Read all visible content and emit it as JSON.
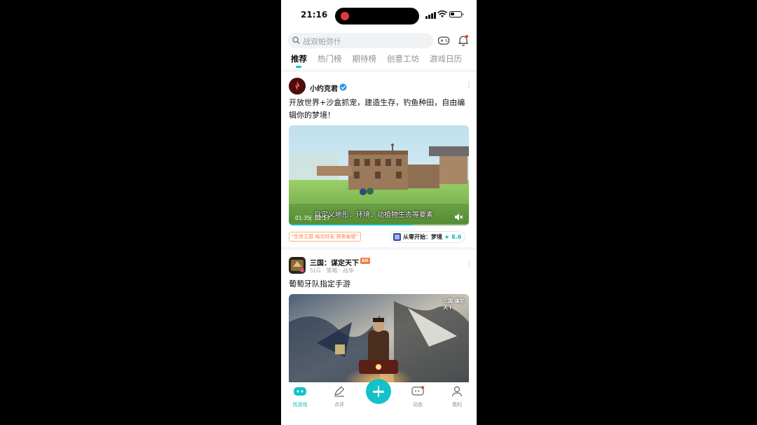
{
  "status_bar": {
    "time": "21:16"
  },
  "search": {
    "placeholder": "战双帕弥什"
  },
  "tabs": [
    {
      "label": "推荐"
    },
    {
      "label": "热门榜"
    },
    {
      "label": "期待榜"
    },
    {
      "label": "创意工坊"
    },
    {
      "label": "游戏日历"
    }
  ],
  "post1": {
    "author": "小约克君",
    "text": "开放世界+沙盒抓宠，建造生存，钓鱼种田，自由编辑你的梦境！",
    "video": {
      "caption": "自定义地形、环境、动植物生态等要素",
      "elapsed": "01:35",
      "total": "02:17",
      "progress": 0.69
    },
    "tag": "\"生存主题 结交好友 探索秘密\"",
    "game": {
      "name": "从零开始：梦境",
      "score": "8.6"
    }
  },
  "post2": {
    "author": "三国：谋定天下",
    "ad_label": "AD",
    "meta": "SLG · 策略 · 战争",
    "text": "葡萄牙队指定手游",
    "banner_logo": "三国 谋定天下"
  },
  "bottom_nav": [
    {
      "label": "找游戏"
    },
    {
      "label": "点评"
    },
    {
      "label": "动态"
    },
    {
      "label": "我的"
    }
  ],
  "colors": {
    "accent": "#14c1c9",
    "ad": "#f37a3a",
    "tag": "#ff7a3d"
  }
}
